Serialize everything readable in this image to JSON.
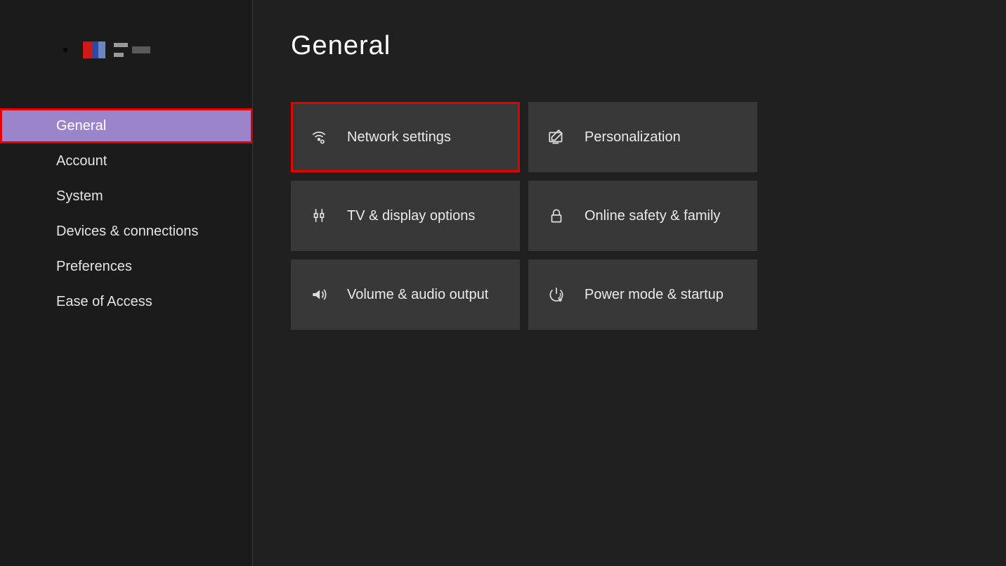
{
  "page_title": "General",
  "sidebar": {
    "items": [
      {
        "label": "General",
        "selected": true,
        "highlight": true
      },
      {
        "label": "Account"
      },
      {
        "label": "System"
      },
      {
        "label": "Devices & connections"
      },
      {
        "label": "Preferences"
      },
      {
        "label": "Ease of Access"
      }
    ]
  },
  "tiles": [
    {
      "icon": "network",
      "label": "Network settings",
      "highlight": true
    },
    {
      "icon": "personalization",
      "label": "Personalization"
    },
    {
      "icon": "display",
      "label": "TV & display options"
    },
    {
      "icon": "lock",
      "label": "Online safety & family"
    },
    {
      "icon": "volume",
      "label": "Volume & audio output"
    },
    {
      "icon": "power",
      "label": "Power mode & startup"
    }
  ]
}
